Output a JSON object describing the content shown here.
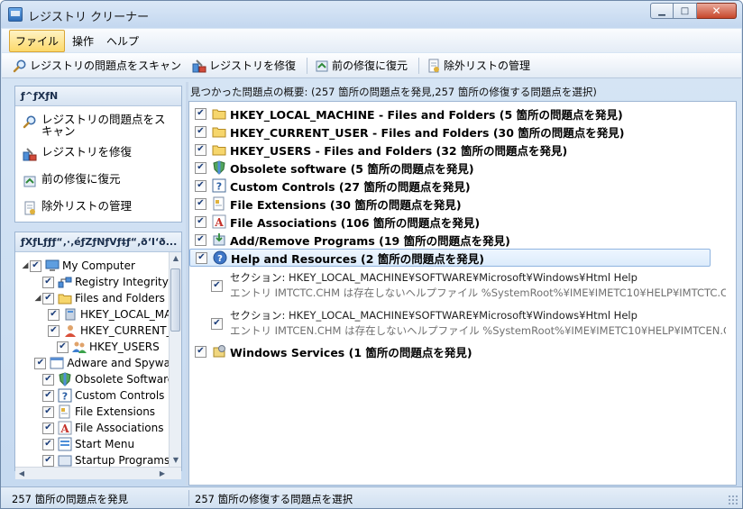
{
  "window": {
    "title": "レジストリ クリーナー",
    "minimize": "▁",
    "maximize": "□",
    "close": "✕"
  },
  "menu": [
    "ファイル",
    "操作",
    "ヘルプ"
  ],
  "toolbar": {
    "scan": "レジストリの問題点をスキャン",
    "repair": "レジストリを修復",
    "restore": "前の修復に復元",
    "exclusions": "除外リストの管理"
  },
  "tasks_panel": {
    "header": "ƒ^ƒXƒN",
    "items": [
      "レジストリの問題点をスキャン",
      "レジストリを修復",
      "前の修復に復元",
      "除外リストの管理"
    ]
  },
  "tree_panel": {
    "header": "ƒXƒLƒƒƒ“‚·‚éƒZƒNƒVƒ‡ƒ“‚ð‘I‘ð...",
    "items": [
      {
        "label": "My Computer",
        "expander": "◢",
        "icon": "computer-icon"
      },
      {
        "label": "Registry Integrity",
        "expander": "",
        "icon": "network-icon"
      },
      {
        "label": "Files and Folders",
        "expander": "◢",
        "icon": "folder-icon"
      },
      {
        "label": "HKEY_LOCAL_MACHINE",
        "expander": "",
        "icon": "machine-icon"
      },
      {
        "label": "HKEY_CURRENT_USER",
        "expander": "",
        "icon": "user-icon"
      },
      {
        "label": "HKEY_USERS",
        "expander": "",
        "icon": "users-icon"
      },
      {
        "label": "Adware and Spyware",
        "expander": "",
        "icon": "window-icon"
      },
      {
        "label": "Obsolete Software",
        "expander": "",
        "icon": "shield-icon"
      },
      {
        "label": "Custom Controls",
        "expander": "",
        "icon": "question-icon"
      },
      {
        "label": "File Extensions",
        "expander": "",
        "icon": "document-icon"
      },
      {
        "label": "File Associations",
        "expander": "",
        "icon": "font-icon"
      },
      {
        "label": "Start Menu",
        "expander": "",
        "icon": "menu-icon"
      },
      {
        "label": "Startup Programs",
        "expander": "",
        "icon": "startup-icon"
      }
    ]
  },
  "summary": "見つかった問題点の概要: (257 箇所の問題点を発見,257 箇所の修復する問題点を選択)",
  "results": [
    {
      "label": "HKEY_LOCAL_MACHINE - Files and Folders  (5 箇所の問題点を発見)",
      "icon": "folder-icon",
      "checked": true
    },
    {
      "label": "HKEY_CURRENT_USER - Files and Folders  (30 箇所の問題点を発見)",
      "icon": "folder-icon",
      "checked": true
    },
    {
      "label": "HKEY_USERS - Files and Folders  (32 箇所の問題点を発見)",
      "icon": "folder-icon",
      "checked": true
    },
    {
      "label": "Obsolete software  (5 箇所の問題点を発見)",
      "icon": "shield-icon",
      "checked": true
    },
    {
      "label": "Custom Controls  (27 箇所の問題点を発見)",
      "icon": "question-icon",
      "checked": true
    },
    {
      "label": "File Extensions  (30 箇所の問題点を発見)",
      "icon": "document-icon",
      "checked": true
    },
    {
      "label": "File Associations  (106 箇所の問題点を発見)",
      "icon": "font-icon",
      "checked": true
    },
    {
      "label": "Add/Remove Programs  (19 箇所の問題点を発見)",
      "icon": "install-icon",
      "checked": true
    },
    {
      "label": "Help and Resources  (2 箇所の問題点を発見)",
      "icon": "help-icon",
      "checked": true
    }
  ],
  "details": [
    {
      "section": "セクション: HKEY_LOCAL_MACHINE¥SOFTWARE¥Microsoft¥Windows¥Html Help",
      "entry": "エントリ IMTCTC.CHM は存在しないヘルプファイル %SystemRoot%¥IME¥IMETC10¥HELP¥IMTCTC.CHM を"
    },
    {
      "section": "セクション: HKEY_LOCAL_MACHINE¥SOFTWARE¥Microsoft¥Windows¥Html Help",
      "entry": "エントリ IMTCEN.CHM は存在しないヘルプファイル %SystemRoot%¥IME¥IMETC10¥HELP¥IMTCEN.CHM を"
    }
  ],
  "last_result": {
    "label": "Windows Services  (1 箇所の問題点を発見)",
    "icon": "services-icon",
    "checked": true
  },
  "check_mark": "✔",
  "status": {
    "left": "257 箇所の問題点を発見",
    "right": "257 箇所の修復する問題点を選択"
  }
}
